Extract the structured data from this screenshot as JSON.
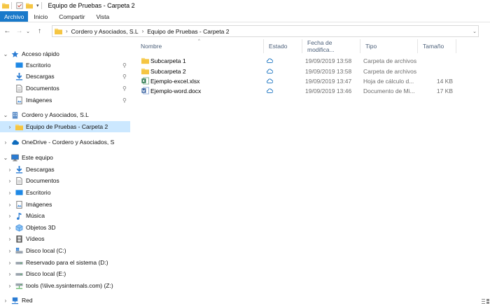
{
  "window": {
    "title": "Equipo de Pruebas - Carpeta 2"
  },
  "ribbon": {
    "tabs": [
      "Archivo",
      "Inicio",
      "Compartir",
      "Vista"
    ]
  },
  "address": {
    "crumbs": [
      "Cordero y Asociados, S.L",
      "Equipo de Pruebas - Carpeta 2"
    ]
  },
  "colors": {
    "accent": "#1979ca",
    "selection": "#cce8ff",
    "folder": "#f8d775",
    "cloud": "#0f6cbd"
  },
  "sidebar": {
    "quick_access": {
      "label": "Acceso rápido",
      "items": [
        "Escritorio",
        "Descargas",
        "Documentos",
        "Imágenes"
      ]
    },
    "org": {
      "label": "Cordero y Asociados, S.L",
      "child": "Equipo de Pruebas - Carpeta 2"
    },
    "onedrive": "OneDrive - Cordero y Asociados, S",
    "this_pc": {
      "label": "Este equipo",
      "items": [
        "Descargas",
        "Documentos",
        "Escritorio",
        "Imágenes",
        "Música",
        "Objetos 3D",
        "Vídeos",
        "Disco local (C:)",
        "Reservado para el sistema (D:)",
        "Disco local (E:)",
        "tools (\\\\live.sysinternals.com) (Z:)"
      ]
    },
    "network": "Red"
  },
  "list": {
    "columns": {
      "name": "Nombre",
      "status": "Estado",
      "date": "Fecha de modifica...",
      "type": "Tipo",
      "size": "Tamaño"
    },
    "files": [
      {
        "name": "Subcarpeta 1",
        "date": "19/09/2019 13:58",
        "type": "Carpeta de archivos",
        "size": "",
        "icon": "folder-icon"
      },
      {
        "name": "Subcarpeta 2",
        "date": "19/09/2019 13:58",
        "type": "Carpeta de archivos",
        "size": "",
        "icon": "folder-icon"
      },
      {
        "name": "Ejemplo-excel.xlsx",
        "date": "19/09/2019 13:47",
        "type": "Hoja de cálculo d...",
        "size": "14 KB",
        "icon": "excel-file-icon"
      },
      {
        "name": "Ejemplo-word.docx",
        "date": "19/09/2019 13:46",
        "type": "Documento de Mi...",
        "size": "17 KB",
        "icon": "word-file-icon"
      }
    ]
  }
}
